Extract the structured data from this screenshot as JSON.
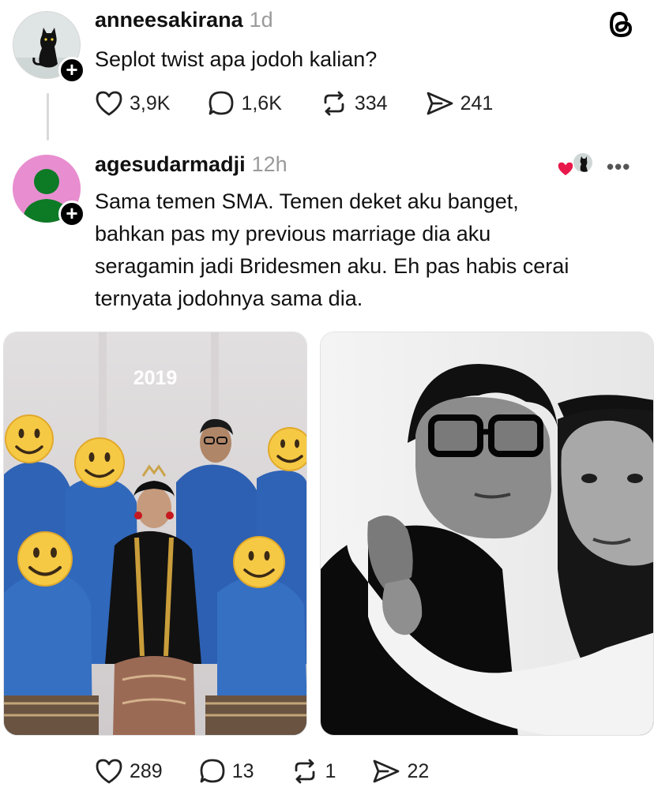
{
  "app": {
    "logo_icon": "threads-logo-icon"
  },
  "original_post": {
    "username": "anneesakirana",
    "time_ago": "1d",
    "text": "Seplot twist apa jodoh kalian?",
    "actions": {
      "likes": "3,9K",
      "replies": "1,6K",
      "reposts": "334",
      "shares": "241"
    }
  },
  "reply_post": {
    "username": "agesudarmadji",
    "time_ago": "12h",
    "text_lines": [
      "Sama temen SMA. Temen deket aku banget,",
      "bahkan pas my previous marriage dia aku",
      "seragamin jadi Bridesmen aku. Eh pas habis cerai",
      "ternyata jodohnya sama dia."
    ],
    "photos": [
      {
        "overlay_text": "2019",
        "icon": "group-photo"
      },
      {
        "overlay_text": "",
        "icon": "couple-photo"
      }
    ],
    "actions": {
      "likes": "289",
      "replies": "13",
      "reposts": "1",
      "shares": "22"
    }
  },
  "colors": {
    "heart_red": "#e8184a",
    "avatar_pink": "#e88ed0",
    "avatar_green": "#0d7a26",
    "muted_text": "#9a9a9a",
    "shirt_blue": "#2f63b6"
  }
}
